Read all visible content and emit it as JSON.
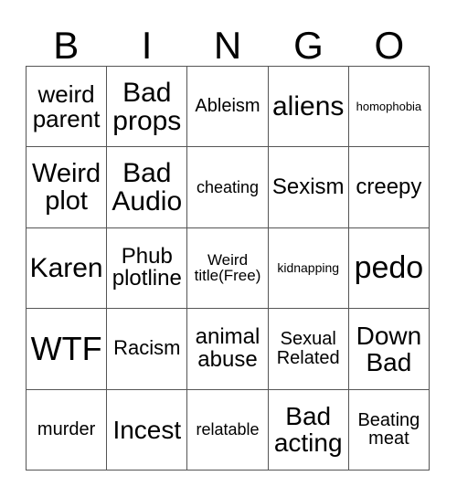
{
  "card": {
    "type": "bingo-card",
    "grid_size": 5,
    "background_color": "#ffffff",
    "border_color": "#555555",
    "text_color": "#000000",
    "header": {
      "letters": [
        "B",
        "I",
        "N",
        "G",
        "O"
      ]
    },
    "free_space": {
      "row": 3,
      "column": 3,
      "label": "Weird title(Free)"
    },
    "rows": [
      [
        {
          "label": "weird\nparent",
          "font_size": 26
        },
        {
          "label": "Bad\nprops",
          "font_size": 30
        },
        {
          "label": "Ableism",
          "font_size": 20
        },
        {
          "label": "aliens",
          "font_size": 30
        },
        {
          "label": "homophobia",
          "font_size": 13
        }
      ],
      [
        {
          "label": "Weird\nplot",
          "font_size": 29
        },
        {
          "label": "Bad\nAudio",
          "font_size": 30
        },
        {
          "label": "cheating",
          "font_size": 18
        },
        {
          "label": "Sexism",
          "font_size": 24
        },
        {
          "label": "creepy",
          "font_size": 24
        }
      ],
      [
        {
          "label": "Karen",
          "font_size": 30
        },
        {
          "label": "Phub\nplotline",
          "font_size": 24
        },
        {
          "label": "Weird\ntitle(Free)",
          "font_size": 17
        },
        {
          "label": "kidnapping",
          "font_size": 14
        },
        {
          "label": "pedo",
          "font_size": 34
        }
      ],
      [
        {
          "label": "WTF",
          "font_size": 36
        },
        {
          "label": "Racism",
          "font_size": 22
        },
        {
          "label": "animal\nabuse",
          "font_size": 24
        },
        {
          "label": "Sexual\nRelated",
          "font_size": 20
        },
        {
          "label": "Down\nBad",
          "font_size": 28
        }
      ],
      [
        {
          "label": "murder",
          "font_size": 20
        },
        {
          "label": "Incest",
          "font_size": 28
        },
        {
          "label": "relatable",
          "font_size": 18
        },
        {
          "label": "Bad\nacting",
          "font_size": 28
        },
        {
          "label": "Beating\nmeat",
          "font_size": 20
        }
      ]
    ]
  }
}
